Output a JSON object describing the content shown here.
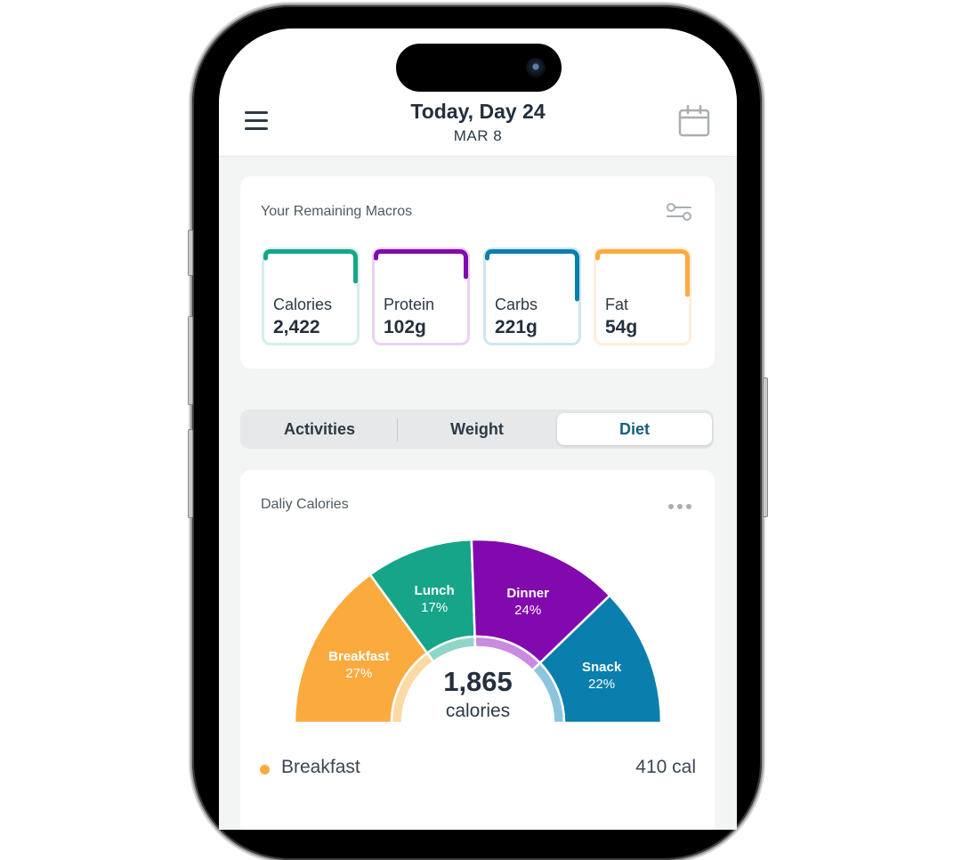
{
  "header": {
    "title": "Today, Day 24",
    "date": "MAR 8",
    "menu_icon": "hamburger-menu-icon",
    "calendar_icon": "calendar-icon"
  },
  "macros_card": {
    "title": "Your Remaining Macros",
    "settings_icon": "sliders-icon",
    "items": [
      {
        "label": "Calories",
        "value": "2,422",
        "color": "#17a589",
        "light": "#d4efea",
        "progress": 0.2
      },
      {
        "label": "Protein",
        "value": "102g",
        "color": "#8209ad",
        "light": "#ead2f3",
        "progress": 0.15
      },
      {
        "label": "Carbs",
        "value": "221g",
        "color": "#0a7fad",
        "light": "#cfe6f0",
        "progress": 0.4
      },
      {
        "label": "Fat",
        "value": "54g",
        "color": "#fbab3d",
        "light": "#feeedb",
        "progress": 0.35
      }
    ]
  },
  "tabs": {
    "items": [
      "Activities",
      "Weight",
      "Diet"
    ],
    "active": "Diet"
  },
  "calories_card": {
    "title": "Daliy Calories",
    "more_icon": "more-dots-icon",
    "total_value": "1,865",
    "total_label": "calories"
  },
  "legend": [
    {
      "name": "Breakfast",
      "value": "410 cal",
      "color": "#fbab3d"
    }
  ],
  "chart_data": {
    "type": "pie",
    "subtype": "half-donut",
    "title": "Daliy Calories",
    "center_value": "1,865",
    "center_label": "calories",
    "categories": [
      "Breakfast",
      "Lunch",
      "Dinner",
      "Snack"
    ],
    "values": [
      27,
      17,
      24,
      22
    ],
    "labels": [
      "27%",
      "17%",
      "24%",
      "22%"
    ],
    "colors": [
      "#fbab3d",
      "#17a589",
      "#8209ad",
      "#0a7fad"
    ],
    "inner_colors": [
      "#fdd9a3",
      "#8fd6c8",
      "#c98be0",
      "#8cc5dd"
    ],
    "legend": "bottom"
  }
}
